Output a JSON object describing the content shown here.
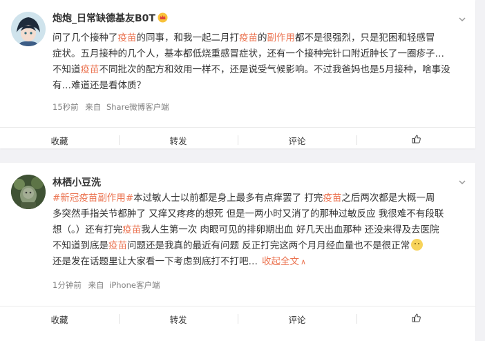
{
  "posts": [
    {
      "user": {
        "name": "炮炮_日常缺德基友B0T"
      },
      "content": {
        "lines": [
          [
            {
              "t": "问了几个接种了",
              "h": false
            },
            {
              "t": "疫苗",
              "h": true
            },
            {
              "t": "的同事，和我一起二月打",
              "h": false
            },
            {
              "t": "疫苗",
              "h": true
            },
            {
              "t": "的",
              "h": false
            },
            {
              "t": "副作用",
              "h": true
            },
            {
              "t": "都不是很强烈，只是犯困和轻感冒",
              "h": false
            }
          ],
          [
            {
              "t": "症状。五月接种的几个人，基本都低烧重感冒症状，还有一个接种完针口附近肿长了一圈疹子…",
              "h": false
            }
          ],
          [
            {
              "t": "不知道",
              "h": false
            },
            {
              "t": "疫苗",
              "h": true
            },
            {
              "t": "不同批次的配方和效用一样不，还是说受气候影响。不过我爸妈也是5月接种，啥事没",
              "h": false
            }
          ],
          [
            {
              "t": "有…难道还是看体质？",
              "h": false
            }
          ]
        ]
      },
      "meta": {
        "time": "15秒前",
        "source_prefix": "来自",
        "source": "Share微博客户端"
      },
      "actions": {
        "collect": "收藏",
        "repost": "转发",
        "comment": "评论"
      }
    },
    {
      "user": {
        "name": "林栖小豆洗"
      },
      "content": {
        "lines": [
          [
            {
              "t": "#新冠",
              "h": false,
              "tag": true
            },
            {
              "t": "疫苗",
              "h": true
            },
            {
              "t": "副作用",
              "h": true
            },
            {
              "t": "#",
              "h": false,
              "tag": true
            },
            {
              "t": "本过敏人士以前都是身上最多有点痒罢了 打完",
              "h": false
            },
            {
              "t": "疫苗",
              "h": true
            },
            {
              "t": "之后两次都是大概一周",
              "h": false
            }
          ],
          [
            {
              "t": "多突然手指关节都肿了 又痒又疼疼的想死 但是一两小时又消了的那种过敏反应 我很难不有段联",
              "h": false
            }
          ],
          [
            {
              "t": "想（。）还有打完",
              "h": false
            },
            {
              "t": "疫苗",
              "h": true
            },
            {
              "t": "我人生第一次 肉眼可见的排卵期出血 好几天出血那种 还没来得及去医院",
              "h": false
            }
          ],
          [
            {
              "t": "不知道到底是",
              "h": false
            },
            {
              "t": "疫苗",
              "h": true
            },
            {
              "t": "问题还是我真的最近有问题 反正打完这两个月月经血量也不是很正常",
              "h": false
            }
          ],
          [
            {
              "t": "还是发在话题里让大家看一下考虑到底打不打吧…",
              "h": false
            }
          ]
        ],
        "fold_label": "收起全文",
        "fold_arrow": "∧"
      },
      "meta": {
        "time": "1分钟前",
        "source_prefix": "来自",
        "source": "iPhone客户端"
      },
      "actions": {
        "collect": "收藏",
        "repost": "转发",
        "comment": "评论"
      }
    }
  ],
  "icons": {
    "menu": "chevron-down-icon",
    "crown": "crown-icon",
    "like": "thumbs-up-icon",
    "emoji": "smile-emoji-icon"
  },
  "colors": {
    "highlight": "#eb7350",
    "meta": "#808080",
    "text": "#333333",
    "page_bg": "#f2f2f5"
  }
}
